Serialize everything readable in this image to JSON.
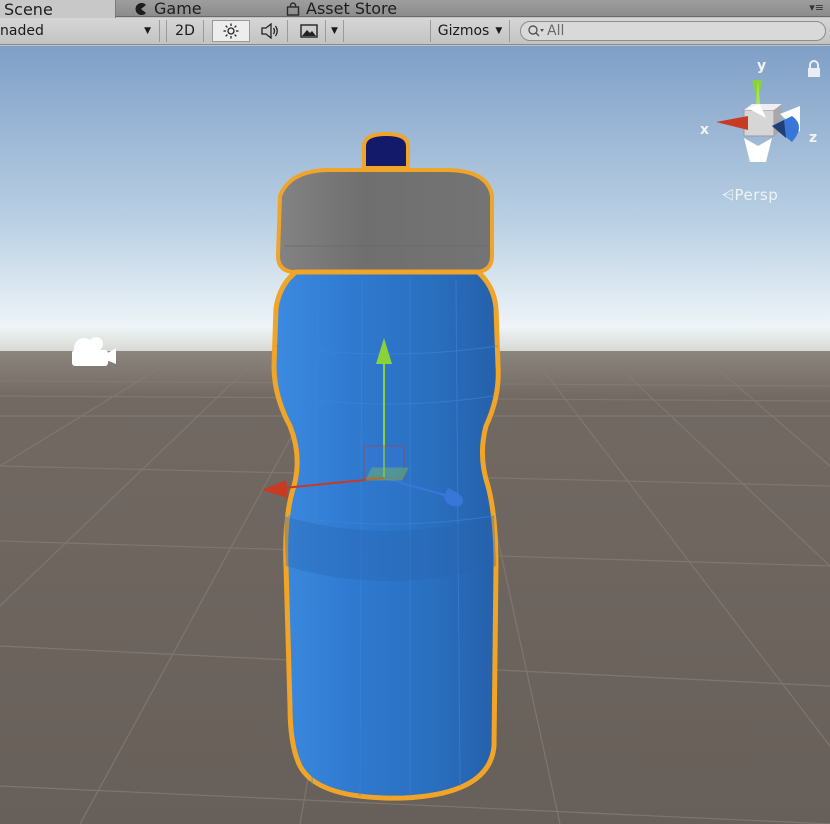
{
  "tabs": [
    {
      "label": "Scene",
      "icon": "grid-icon"
    },
    {
      "label": "Game",
      "icon": "pacman-icon"
    },
    {
      "label": "Asset Store",
      "icon": "shopping-bag-icon"
    }
  ],
  "toolbar": {
    "draw_mode": "naded",
    "mode_2d": "2D",
    "lighting_icon": "sun-icon",
    "audio_icon": "speaker-icon",
    "effects_icon": "image-icon",
    "gizmos_label": "Gizmos",
    "search_placeholder": "All"
  },
  "scene_gizmo": {
    "axis_labels": {
      "x": "x",
      "y": "y",
      "z": "z"
    },
    "projection_label": "Persp",
    "axis_colors": {
      "x": "#c93a22",
      "y": "#8bd23a",
      "z": "#3a76d8"
    }
  },
  "scene": {
    "sky_top": "#7f9fc7",
    "horizon": "#f2f6f8",
    "ground": "#6a625c",
    "selection_outline": "#f0a428",
    "bottle_color": "#2f78c8",
    "cap_color": "#727272",
    "nozzle_color": "#141a6a",
    "camera_icon": "camera-icon",
    "lock_icon": "lock-icon"
  }
}
